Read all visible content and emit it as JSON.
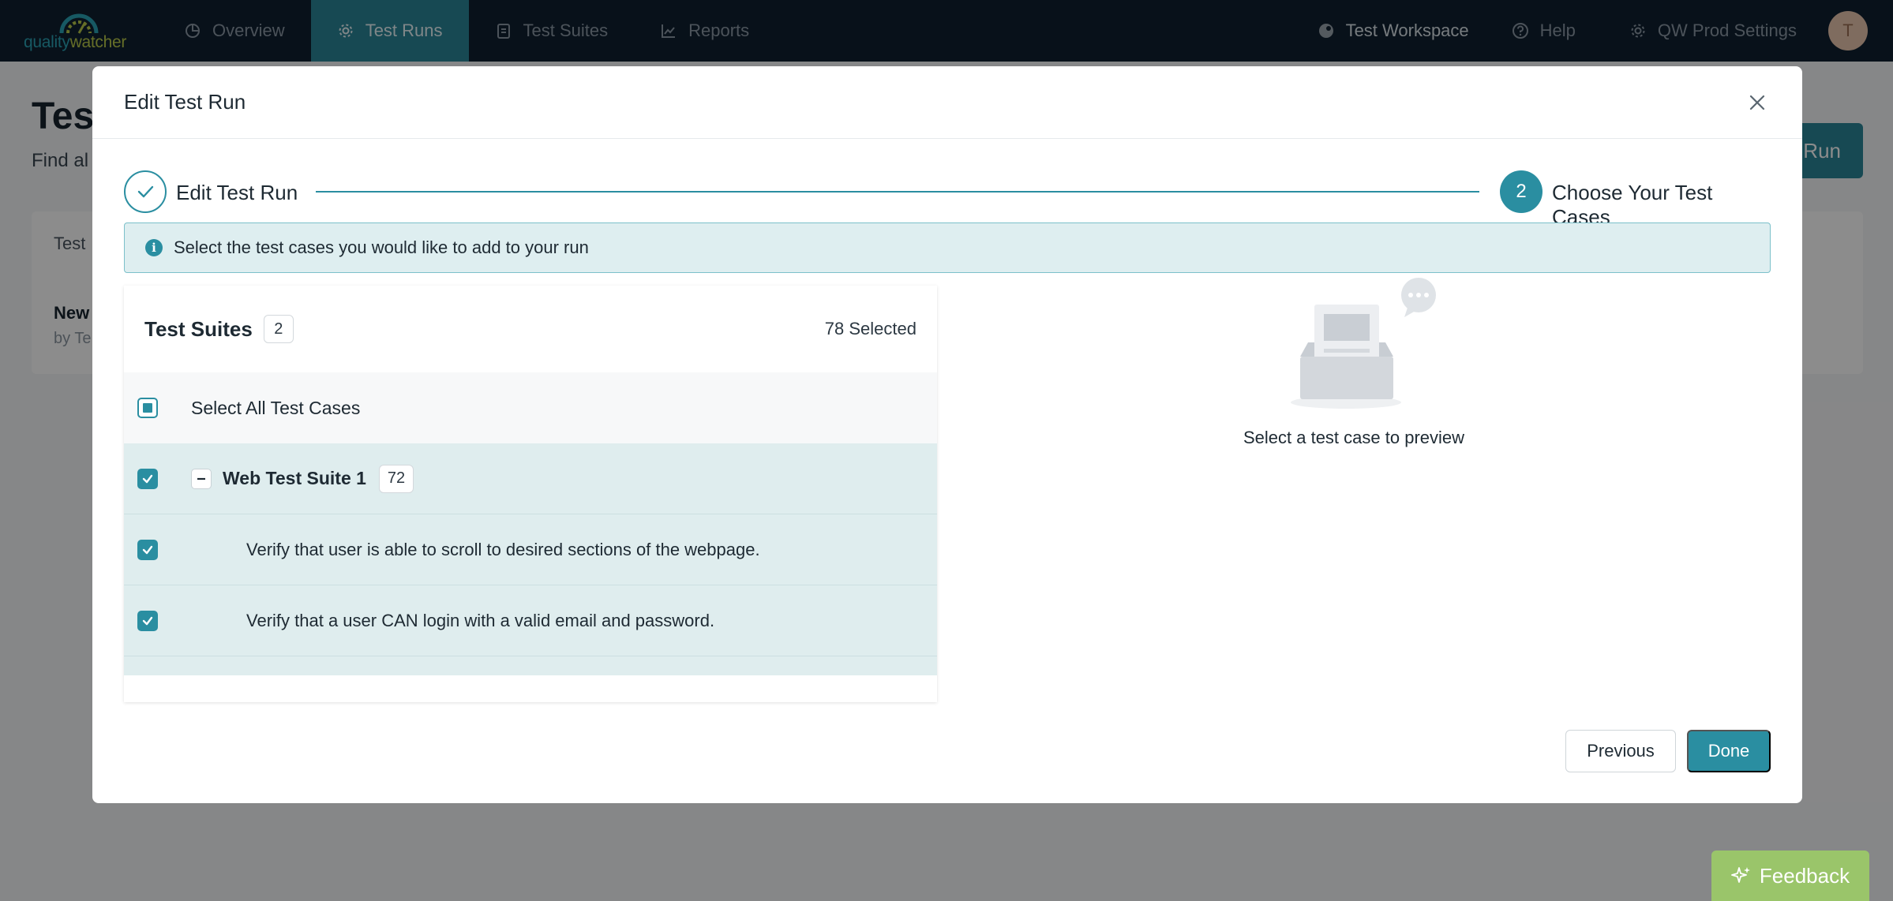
{
  "brand": {
    "quality": "quality",
    "watcher": "watcher"
  },
  "nav": {
    "items": [
      {
        "label": "Overview",
        "icon": "pie-chart-icon",
        "active": false
      },
      {
        "label": "Test Runs",
        "icon": "gear-icon",
        "active": true
      },
      {
        "label": "Test Suites",
        "icon": "clipboard-icon",
        "active": false
      },
      {
        "label": "Reports",
        "icon": "line-chart-icon",
        "active": false
      }
    ],
    "workspace": "Test Workspace",
    "help": "Help",
    "settings": "QW Prod Settings",
    "avatar_initial": "T"
  },
  "background": {
    "title": "Test",
    "subtitle": "Find al",
    "card_header": "Test",
    "row_name": "New",
    "row_by": "by Te",
    "run_button": "Run"
  },
  "modal": {
    "title": "Edit Test Run",
    "steps": [
      {
        "label": "Edit Test Run",
        "state": "complete"
      },
      {
        "label": "Choose Your Test Cases",
        "number": "2",
        "state": "current"
      }
    ],
    "alert": "Select the test cases you would like to add to your run",
    "panel": {
      "title": "Test Suites",
      "suite_count": "2",
      "selected": "78 Selected",
      "select_all": "Select All Test Cases",
      "suite": {
        "name": "Web Test Suite 1",
        "count": "72"
      },
      "cases": [
        "Verify that user is able to scroll to desired sections of the webpage.",
        "Verify that a user CAN login with a valid email and password."
      ]
    },
    "preview_text": "Select a test case to preview",
    "previous": "Previous",
    "done": "Done"
  },
  "feedback": "Feedback",
  "colors": {
    "accent": "#2a8ea1",
    "nav_bg": "#0f2030",
    "feedback": "#9ac56a"
  }
}
